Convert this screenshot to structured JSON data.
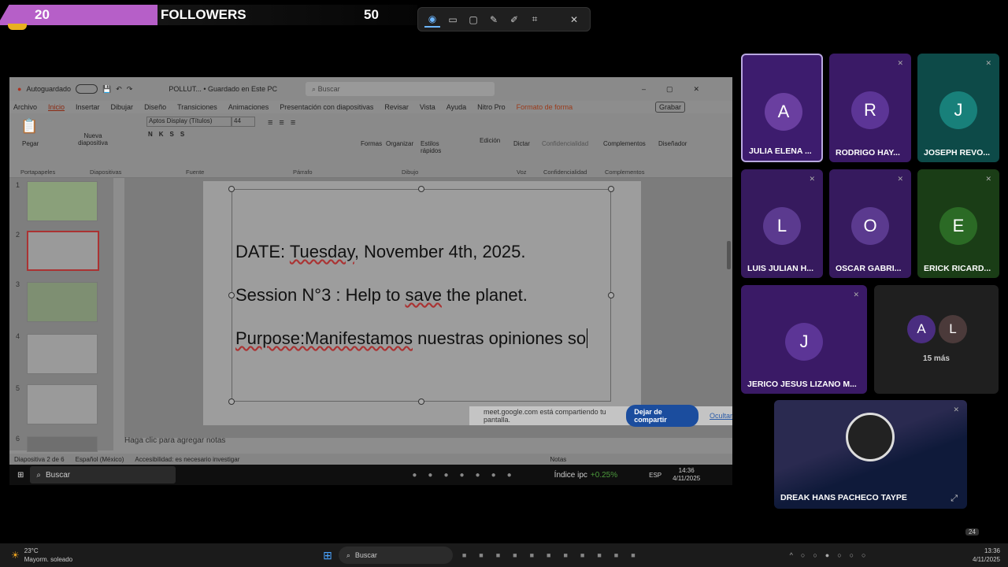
{
  "banner": {
    "count_left": "20",
    "label": "FOLLOWERS",
    "count_right": "50"
  },
  "snip": {
    "icons": [
      "camera-icon",
      "video-icon",
      "rectangle-select-icon",
      "edit-icon",
      "pen-icon",
      "text-extract-icon",
      "close-icon"
    ]
  },
  "ppt": {
    "autosave": "Autoguardado",
    "title": "POLLUT... • Guardado en Este PC",
    "search": "Buscar",
    "menu": [
      "Archivo",
      "Inicio",
      "Insertar",
      "Dibujar",
      "Diseño",
      "Transiciones",
      "Animaciones",
      "Presentación con diapositivas",
      "Revisar",
      "Vista",
      "Ayuda",
      "Nitro Pro",
      "Formato de forma"
    ],
    "record": "Grabar",
    "ribbon": {
      "paste": "Pegar",
      "new_slide": "Nueva diapositiva",
      "font": "Aptos Display (Títulos)",
      "size": "44",
      "shapes": "Formas",
      "arrange": "Organizar",
      "styles": "Estilos rápidos",
      "edit": "Edición",
      "dictate": "Dictar",
      "confidentiality": "Confidencialidad",
      "addins": "Complementos",
      "designer": "Diseñador",
      "groups": [
        "Portapapeles",
        "Diapositivas",
        "Fuente",
        "Párrafo",
        "Dibujo",
        "Voz",
        "Confidencialidad",
        "Complementos"
      ]
    },
    "thumbs": [
      "1",
      "2",
      "3",
      "4",
      "5",
      "6"
    ],
    "slide": {
      "line1_a": "DATE: ",
      "line1_b": "Tuesday",
      "line1_c": ", November 4th, 2025.",
      "line2_a": "Session N°3 : Help to ",
      "line2_b": "save",
      "line2_c": " the planet.",
      "line3_a": "Purpose:Manifestamos",
      "line3_b": " nuestras opiniones so"
    },
    "notes": "Haga clic para agregar notas",
    "status": {
      "slide": "Diapositiva 2 de 6",
      "lang": "Español (México)",
      "access": "Accesibilidad: es necesario investigar",
      "notes": "Notas"
    }
  },
  "share": {
    "msg": "meet.google.com está compartiendo tu pantalla.",
    "stop": "Dejar de compartir",
    "hide": "Ocultar"
  },
  "inner_taskbar": {
    "search": "Buscar",
    "stock": "Índice ipc",
    "stock_change": "+0.25%",
    "lang": "ESP",
    "time": "14:36",
    "date": "4/11/2025"
  },
  "participants": [
    {
      "initial": "A",
      "name": "JULIA ELENA ...",
      "bg": "#3d1c6e",
      "avbg": "#6a3fa0"
    },
    {
      "initial": "R",
      "name": "RODRIGO HAY...",
      "bg": "#3a1a66",
      "avbg": "#5c3596"
    },
    {
      "initial": "J",
      "name": "JOSEPH REVO...",
      "bg": "#0d4a48",
      "avbg": "#18807a"
    },
    {
      "initial": "L",
      "name": "LUIS JULIAN H...",
      "bg": "#361a5e",
      "avbg": "#5b3a8f"
    },
    {
      "initial": "O",
      "name": "OSCAR GABRI...",
      "bg": "#361a5e",
      "avbg": "#5b3a8f"
    },
    {
      "initial": "E",
      "name": "ERICK RICARD...",
      "bg": "#1a3d16",
      "avbg": "#2b6a25"
    },
    {
      "initial": "J",
      "name": "JERICO JESUS LIZANO M...",
      "bg": "#3a1a66",
      "avbg": "#5c3596"
    }
  ],
  "more": {
    "a": "A",
    "l": "L",
    "label": "15 más"
  },
  "presenter": {
    "name": "DREAK HANS PACHECO TAYPE"
  },
  "taskbar": {
    "weather": "23°C",
    "weather_desc": "Mayorm. soleado",
    "search": "Buscar",
    "time": "13:36",
    "date": "4/11/2025",
    "badge": "24"
  }
}
